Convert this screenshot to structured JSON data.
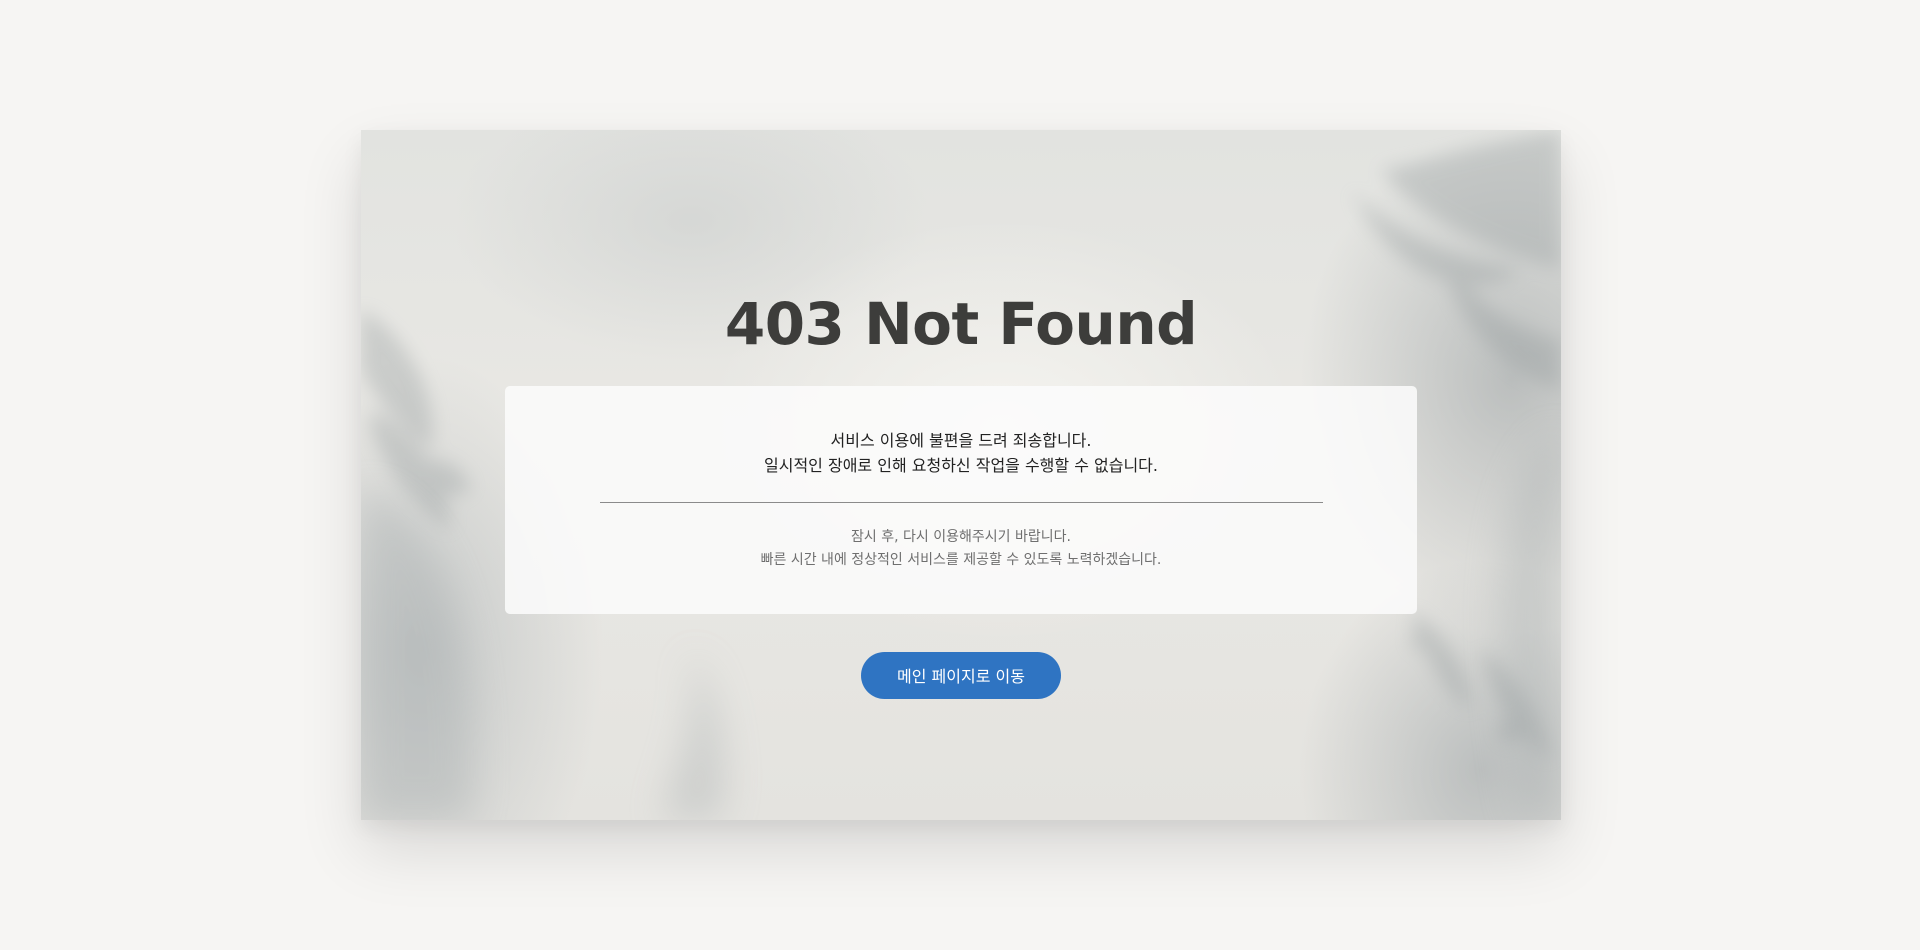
{
  "error": {
    "title": "403 Not Found",
    "message_line1": "서비스 이용에 불편을 드려 죄송합니다.",
    "message_line2": "일시적인 장애로 인해 요청하신 작업을 수행할 수 없습니다.",
    "detail_line1": "잠시 후, 다시 이용해주시기 바랍니다.",
    "detail_line2": "빠른 시간 내에 정상적인 서비스를 제공할 수 있도록 노력하겠습니다."
  },
  "actions": {
    "main_page_label": "메인 페이지로 이동"
  },
  "colors": {
    "button": "#2f74c2",
    "title": "#3d3d3b",
    "page_background": "#f6f5f3"
  }
}
